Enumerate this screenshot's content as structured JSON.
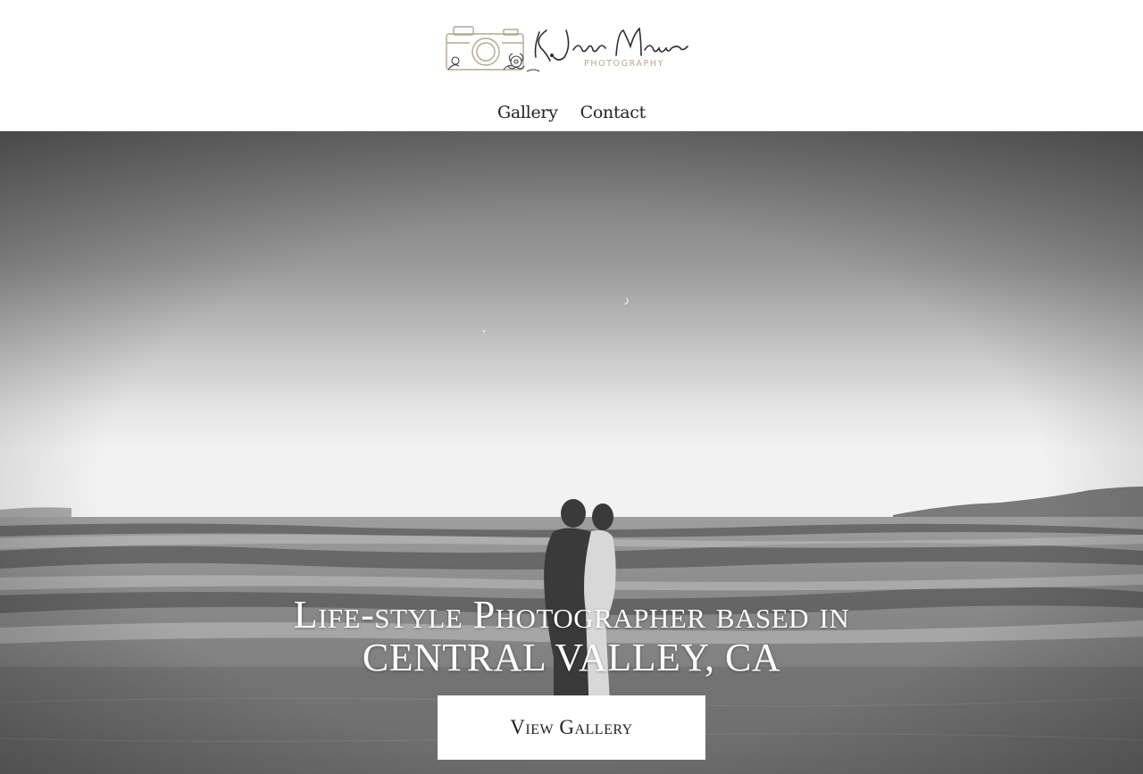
{
  "brand": {
    "name": "K. Jane Moua",
    "tagline": "PHOTOGRAPHY",
    "accent_color": "#b4a98f"
  },
  "nav": {
    "items": [
      {
        "label": "Gallery"
      },
      {
        "label": "Contact"
      }
    ]
  },
  "hero": {
    "title_line1": "Life-style Photographer based in",
    "title_line2": "CENTRAL VALLEY, CA",
    "cta_label": "View Gallery"
  },
  "colors": {
    "header_bg": "#ffffff",
    "nav_text": "#222222",
    "hero_text": "#ffffff",
    "button_bg": "#ffffff",
    "button_text": "#1e1e1e"
  }
}
